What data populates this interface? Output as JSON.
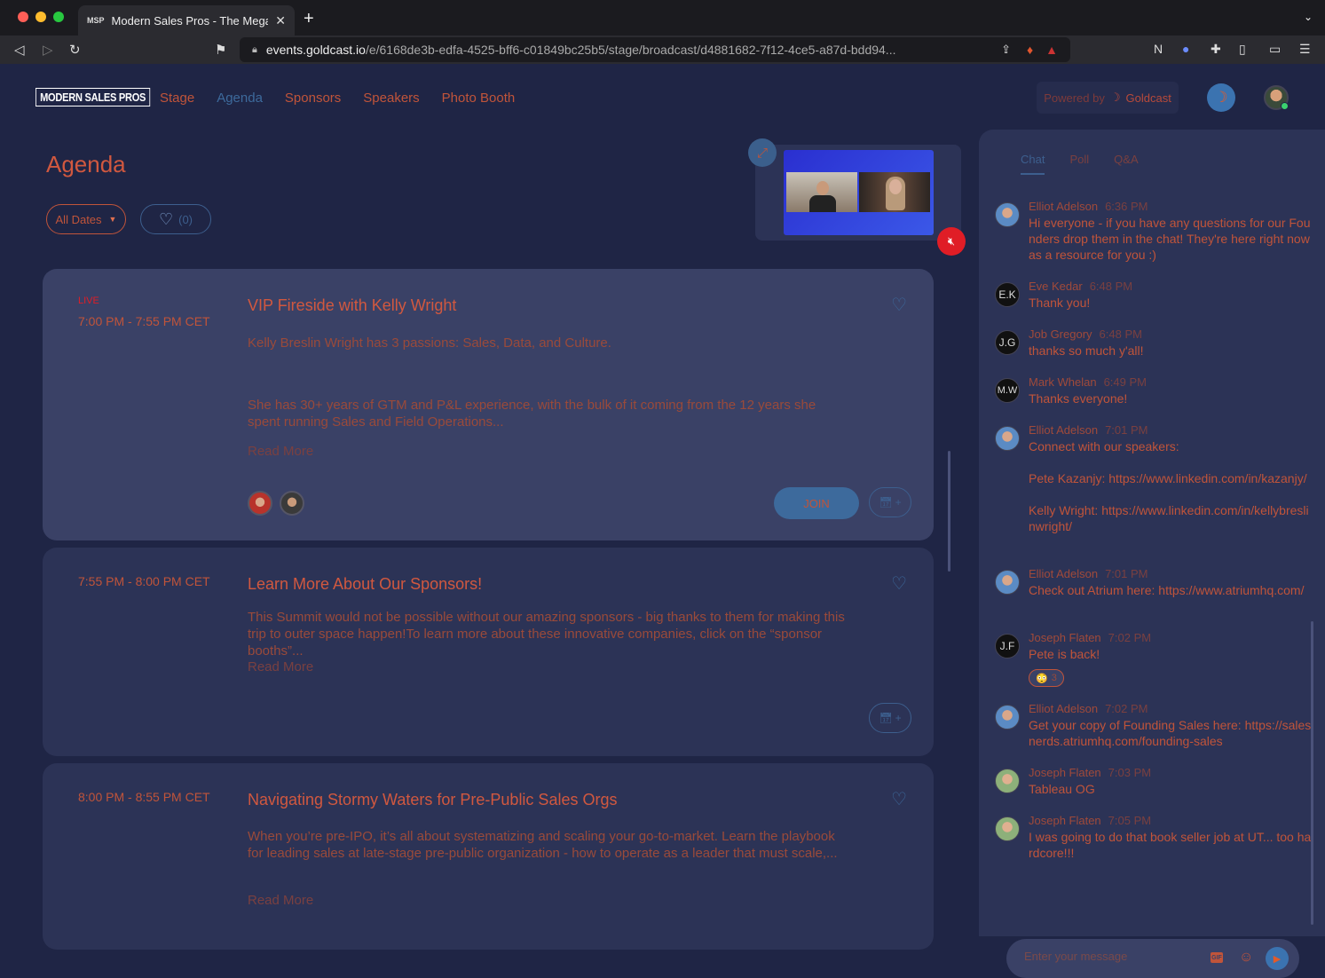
{
  "browser": {
    "tab_favicon": "MSP",
    "tab_title": "Modern Sales Pros - The Mega",
    "url_host": "events.goldcast.io",
    "url_path": "/e/6168de3b-edfa-4525-bff6-c01849bc25b5/stage/broadcast/d4881682-7f12-4ce5-a87d-bdd94..."
  },
  "nav": {
    "logo": "MODERN SALES PROS",
    "links": [
      "Stage",
      "Agenda",
      "Sponsors",
      "Speakers",
      "Photo Booth"
    ],
    "powered_by": "Powered by",
    "powered_brand": "Goldcast"
  },
  "agenda": {
    "title": "Agenda",
    "filter_dates": "All Dates",
    "filter_fav_count": "(0)",
    "sessions": [
      {
        "live_label": "LIVE",
        "time": "7:00 PM - 7:55 PM CET",
        "title": "VIP Fireside with Kelly Wright",
        "desc1": "Kelly Breslin Wright has 3 passions: Sales, Data, and Culture.",
        "desc2": "She has 30+ years of GTM and P&L experience, with the bulk of it coming from the 12 years she spent running Sales and Field Operations...",
        "read_more": "Read More",
        "join": "JOIN"
      },
      {
        "time": "7:55 PM - 8:00 PM CET",
        "title": "Learn More About Our Sponsors!",
        "desc1": "This Summit would not be possible without our amazing sponsors - big thanks to them for making this trip to outer space happen!To learn more about these innovative companies, click on the “sponsor booths”...",
        "read_more": "Read More"
      },
      {
        "time": "8:00 PM - 8:55 PM CET",
        "title": "Navigating Stormy Waters for Pre-Public Sales Orgs",
        "desc1": "When you’re pre-IPO, it’s all about systematizing and scaling your go-to-market. Learn the playbook for leading sales at late-stage pre-public organization - how to operate as a leader that must scale,...",
        "read_more": "Read More"
      }
    ]
  },
  "chat": {
    "tabs": [
      "Chat",
      "Poll",
      "Q&A"
    ],
    "messages": [
      {
        "name": "Elliot Adelson",
        "time": "6:36 PM",
        "text": "Hi everyone - if you have any questions for our Founders drop them in the chat! They're here right now as a resource for you :)"
      },
      {
        "initials": "E.K",
        "name": "Eve Kedar",
        "time": "6:48 PM",
        "text": "Thank you!"
      },
      {
        "initials": "J.G",
        "name": "Job Gregory",
        "time": "6:48 PM",
        "text": "thanks so much y'all!"
      },
      {
        "initials": "M.W",
        "name": "Mark Whelan",
        "time": "6:49 PM",
        "text": "Thanks everyone!"
      },
      {
        "name": "Elliot Adelson",
        "time": "7:01 PM",
        "text": "Connect with our speakers:\n\nPete Kazanjy: https://www.linkedin.com/in/kazanjy/\n\nKelly Wright: https://www.linkedin.com/in/kellybreslinwright/"
      },
      {
        "name": "Elliot Adelson",
        "time": "7:01 PM",
        "text": "Check out Atrium here: https://www.atriumhq.com/"
      },
      {
        "initials": "J.F",
        "name": "Joseph Flaten",
        "time": "7:02 PM",
        "text": "Pete is back!",
        "reaction_count": "3"
      },
      {
        "name": "Elliot Adelson",
        "time": "7:02 PM",
        "text": "Get your copy of Founding Sales here: https://salesnerds.atriumhq.com/founding-sales"
      },
      {
        "name": "Joseph Flaten",
        "time": "7:03 PM",
        "text": "Tableau OG"
      },
      {
        "name": "Joseph Flaten",
        "time": "7:05 PM",
        "text": "I was going to do that book seller job at UT... too hardcore!!!"
      }
    ],
    "input_placeholder": "Enter your message",
    "gif_label": "GIF"
  }
}
